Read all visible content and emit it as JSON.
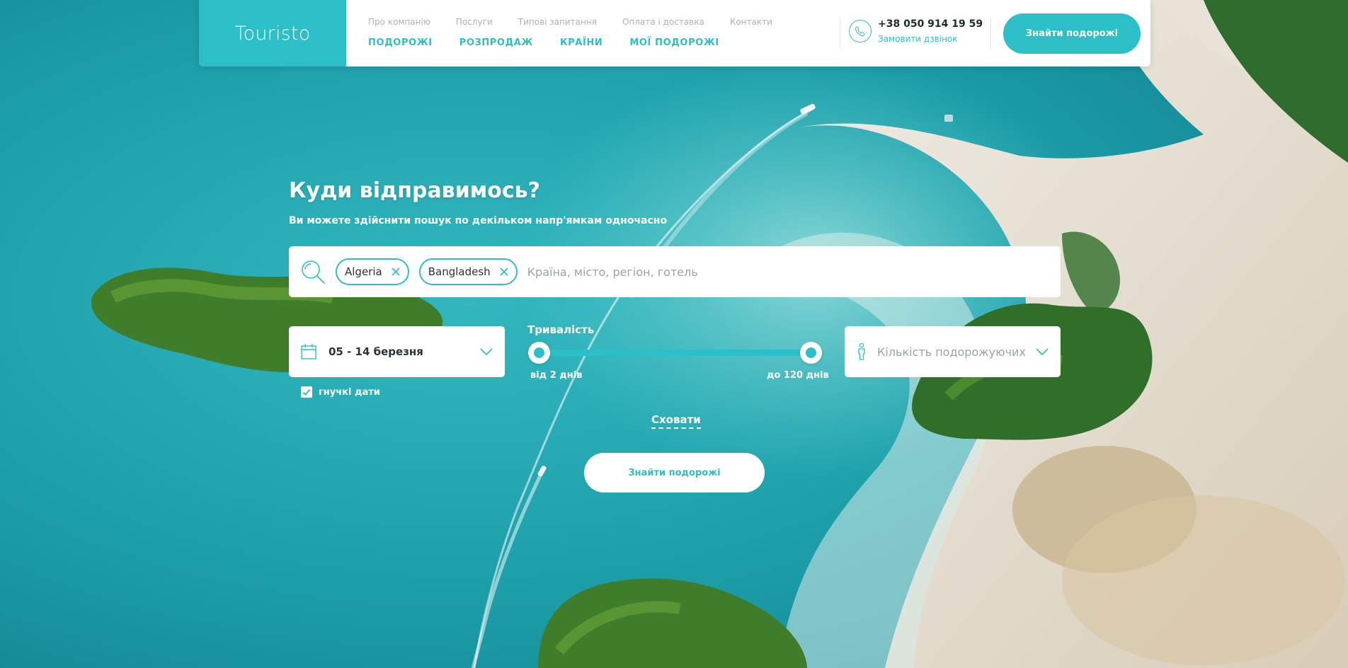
{
  "header": {
    "logo": "Touristo",
    "top_links": [
      "Про компанію",
      "Послуги",
      "Типові запитання",
      "Оплата і доставка",
      "Контакти"
    ],
    "main_links": [
      "ПОДОРОЖІ",
      "РОЗПРОДАЖ",
      "КРАЇНИ",
      "МОЇ ПОДОРОЖІ"
    ],
    "phone": "+38 050 914 19 59",
    "callback": "Замовити дзвінок",
    "cta_label": "Знайти подорожі"
  },
  "hero": {
    "title": "Куди відправимось?",
    "subtitle": "Ви можете здійснити пошук по декільком напр'ямкам одночасно"
  },
  "search": {
    "chips": [
      "Algeria",
      "Bangladesh"
    ],
    "placeholder": "Країна, місто, регіон, готель"
  },
  "dates": {
    "value": "05 - 14 березня",
    "flexible_label": "гнучкі дати",
    "flexible_checked": true
  },
  "duration": {
    "title": "Тривалість",
    "min_label": "від 2 днів",
    "max_label": "до 120 днів"
  },
  "travelers": {
    "placeholder": "Кількість подорожуючих"
  },
  "actions": {
    "hide_label": "Сховати",
    "search_label": "Знайти подорожі"
  },
  "colors": {
    "accent": "#2cbfc7",
    "sea": "#1a9aa6",
    "sand": "#e9e2d6",
    "forest": "#3f7d2a"
  },
  "icons": [
    "search-icon",
    "close-icon",
    "calendar-icon",
    "chevron-down-icon",
    "phone-icon",
    "person-icon",
    "check-icon"
  ]
}
